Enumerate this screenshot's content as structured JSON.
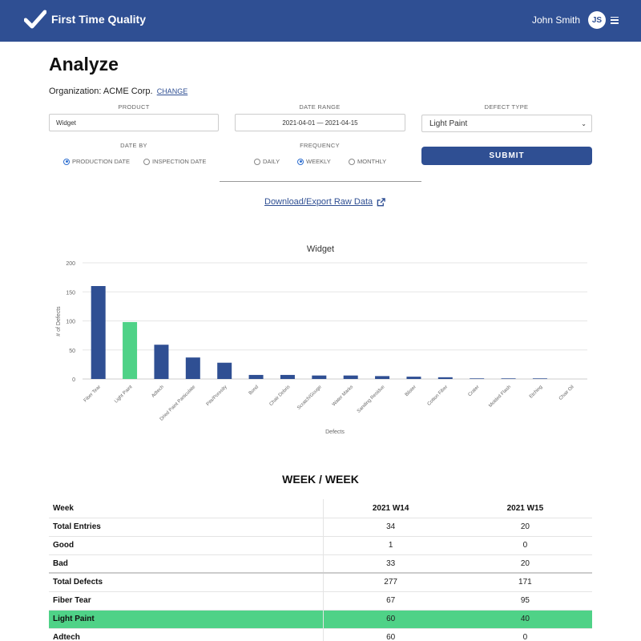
{
  "app": {
    "name": "First Time Quality",
    "user_name": "John Smith",
    "user_initials": "JS"
  },
  "page": {
    "title": "Analyze",
    "org_label": "Organization: ACME Corp.",
    "org_change": "CHANGE"
  },
  "filters": {
    "product_label": "PRODUCT",
    "product_value": "Widget",
    "date_range_label": "DATE RANGE",
    "date_range_value": "2021-04-01 — 2021-04-15",
    "defect_type_label": "DEFECT TYPE",
    "defect_type_value": "Light Paint",
    "date_by_label": "DATE BY",
    "date_by_options": [
      "PRODUCTION DATE",
      "INSPECTION DATE"
    ],
    "date_by_selected": "PRODUCTION DATE",
    "frequency_label": "FREQUENCY",
    "frequency_options": [
      "DAILY",
      "WEEKLY",
      "MONTHLY"
    ],
    "frequency_selected": "WEEKLY",
    "submit_label": "SUBMIT"
  },
  "export_label": "Download/Export Raw Data",
  "colors": {
    "brand": "#2f4f93",
    "bar": "#2f4f93",
    "highlight": "#4fd287"
  },
  "chart_data": {
    "type": "bar",
    "title": "Widget",
    "xlabel": "Defects",
    "ylabel": "# of Defects",
    "ylim": [
      0,
      200
    ],
    "yticks": [
      0,
      50,
      100,
      150,
      200
    ],
    "grid": true,
    "categories": [
      "Fiber Tear",
      "Light Paint",
      "Adtech",
      "Dried Paint Particulate",
      "Pits/Porosity",
      "Bond",
      "Chair Debris",
      "Scratch/Gouge",
      "Water Marks",
      "Sanding Residue",
      "Blister",
      "Cotton Fiber",
      "Crater",
      "Molded Flash",
      "Etching",
      "Chair Oil"
    ],
    "values": [
      160,
      98,
      59,
      37,
      28,
      7,
      7,
      6,
      6,
      5,
      4,
      3,
      1,
      1,
      1,
      0
    ],
    "highlighted": "Light Paint"
  },
  "week_table": {
    "title": "WEEK / WEEK",
    "header": [
      "Week",
      "2021 W14",
      "2021 W15"
    ],
    "rows": [
      {
        "label": "Total Entries",
        "values": [
          "34",
          "20"
        ]
      },
      {
        "label": "Good",
        "values": [
          "1",
          "0"
        ]
      },
      {
        "label": "Bad",
        "values": [
          "33",
          "20"
        ]
      },
      {
        "label": "Total Defects",
        "values": [
          "277",
          "171"
        ]
      },
      {
        "label": "Fiber Tear",
        "values": [
          "67",
          "95"
        ]
      },
      {
        "label": "Light Paint",
        "values": [
          "60",
          "40"
        ]
      },
      {
        "label": "Adtech",
        "values": [
          "60",
          "0"
        ]
      }
    ]
  }
}
